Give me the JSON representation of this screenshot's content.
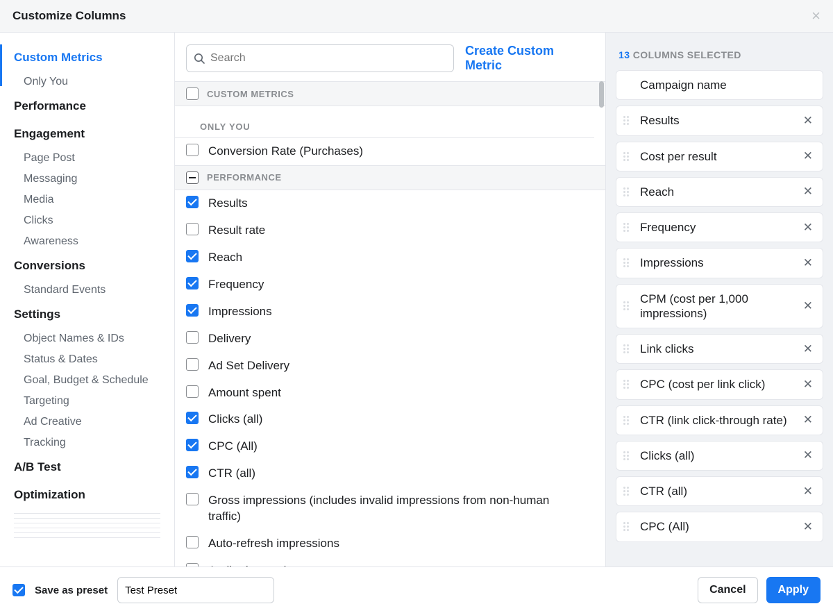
{
  "header": {
    "title": "Customize Columns"
  },
  "search": {
    "placeholder": "Search"
  },
  "create_link": "Create Custom Metric",
  "sidebar": [
    {
      "label": "Custom Metrics",
      "type": "cat",
      "active": true
    },
    {
      "label": "Only You",
      "type": "sub"
    },
    {
      "type": "divider"
    },
    {
      "label": "Performance",
      "type": "cat"
    },
    {
      "type": "divider"
    },
    {
      "label": "Engagement",
      "type": "cat"
    },
    {
      "label": "Page Post",
      "type": "sub"
    },
    {
      "label": "Messaging",
      "type": "sub"
    },
    {
      "label": "Media",
      "type": "sub"
    },
    {
      "label": "Clicks",
      "type": "sub"
    },
    {
      "label": "Awareness",
      "type": "sub"
    },
    {
      "type": "divider"
    },
    {
      "label": "Conversions",
      "type": "cat"
    },
    {
      "label": "Standard Events",
      "type": "sub"
    },
    {
      "type": "divider"
    },
    {
      "label": "Settings",
      "type": "cat"
    },
    {
      "label": "Object Names & IDs",
      "type": "sub"
    },
    {
      "label": "Status & Dates",
      "type": "sub"
    },
    {
      "label": "Goal, Budget & Schedule",
      "type": "sub"
    },
    {
      "label": "Targeting",
      "type": "sub"
    },
    {
      "label": "Ad Creative",
      "type": "sub"
    },
    {
      "label": "Tracking",
      "type": "sub"
    },
    {
      "type": "divider"
    },
    {
      "label": "A/B Test",
      "type": "cat"
    },
    {
      "type": "divider"
    },
    {
      "label": "Optimization",
      "type": "cat"
    }
  ],
  "sections": [
    {
      "kind": "head",
      "label": "Custom Metrics",
      "check": "empty"
    },
    {
      "kind": "subhead",
      "label": "Only You"
    },
    {
      "kind": "item",
      "label": "Conversion Rate (Purchases)",
      "checked": false
    },
    {
      "kind": "head",
      "label": "Performance",
      "check": "indeterminate"
    },
    {
      "kind": "item",
      "label": "Results",
      "checked": true
    },
    {
      "kind": "item",
      "label": "Result rate",
      "checked": false
    },
    {
      "kind": "item",
      "label": "Reach",
      "checked": true
    },
    {
      "kind": "item",
      "label": "Frequency",
      "checked": true
    },
    {
      "kind": "item",
      "label": "Impressions",
      "checked": true
    },
    {
      "kind": "item",
      "label": "Delivery",
      "checked": false
    },
    {
      "kind": "item",
      "label": "Ad Set Delivery",
      "checked": false
    },
    {
      "kind": "item",
      "label": "Amount spent",
      "checked": false
    },
    {
      "kind": "item",
      "label": "Clicks (all)",
      "checked": true
    },
    {
      "kind": "item",
      "label": "CPC (All)",
      "checked": true
    },
    {
      "kind": "item",
      "label": "CTR (all)",
      "checked": true
    },
    {
      "kind": "item",
      "label": "Gross impressions (includes invalid impressions from non-human traffic)",
      "checked": false
    },
    {
      "kind": "item",
      "label": "Auto-refresh impressions",
      "checked": false
    },
    {
      "kind": "item",
      "label": "Attribution setting",
      "checked": false
    }
  ],
  "selected": {
    "count": "13",
    "suffix": "Columns Selected",
    "items": [
      {
        "label": "Campaign name",
        "locked": true
      },
      {
        "label": "Results"
      },
      {
        "label": "Cost per result"
      },
      {
        "label": "Reach"
      },
      {
        "label": "Frequency"
      },
      {
        "label": "Impressions"
      },
      {
        "label": "CPM (cost per 1,000 impressions)"
      },
      {
        "label": "Link clicks"
      },
      {
        "label": "CPC (cost per link click)"
      },
      {
        "label": "CTR (link click-through rate)"
      },
      {
        "label": "Clicks (all)"
      },
      {
        "label": "CTR (all)"
      },
      {
        "label": "CPC (All)"
      }
    ]
  },
  "footer": {
    "save_as_preset": "Save as preset",
    "preset_value": "Test Preset",
    "cancel": "Cancel",
    "apply": "Apply"
  }
}
